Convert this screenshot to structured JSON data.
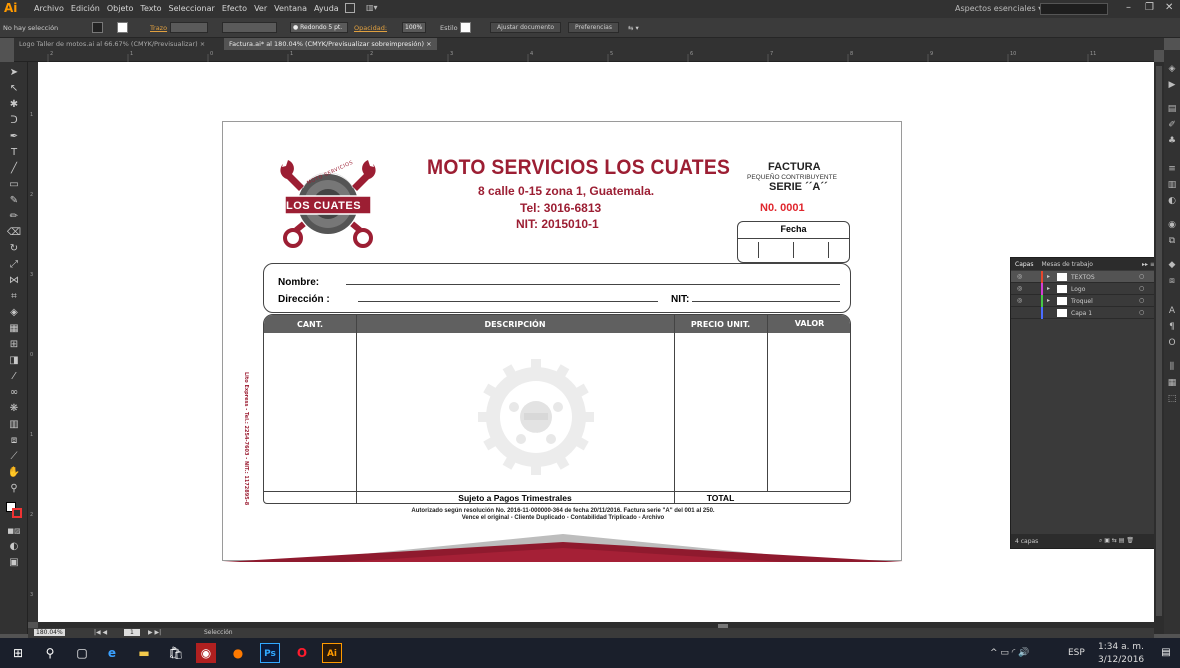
{
  "app": {
    "logo": "Ai",
    "menus": [
      "Archivo",
      "Edición",
      "Objeto",
      "Texto",
      "Seleccionar",
      "Efecto",
      "Ver",
      "Ventana",
      "Ayuda"
    ],
    "workspace": "Aspectos esenciales",
    "window_controls": [
      "–",
      "❐",
      "✕"
    ]
  },
  "controlbar": {
    "selection": "No hay selección",
    "stroke_label": "Trazo",
    "brush": "● Redondo 5 pt.",
    "opacity_label": "Opacidad:",
    "opacity_value": "100%",
    "style_label": "Estilo",
    "fit_doc": "Ajustar documento",
    "prefs": "Preferencias"
  },
  "tabs": [
    {
      "label": "Logo Taller de motos.ai al 66.67% (CMYK/Previsualizar)",
      "close": "×"
    },
    {
      "label": "Factura.ai* al 180.04% (CMYK/Previsualizar sobreimpresión)",
      "close": "×"
    }
  ],
  "ruler_h_ticks": [
    "2",
    "1",
    "0",
    "1",
    "2",
    "3",
    "4",
    "5",
    "6",
    "7",
    "8",
    "9",
    "10",
    "11"
  ],
  "ruler_v_ticks": [
    "1",
    "2",
    "3",
    "0",
    "1",
    "2",
    "3",
    "4"
  ],
  "invoice": {
    "company": "MOTO SERVICIOS LOS CUATES",
    "address": "8 calle 0-15 zona 1, Guatemala.",
    "tel": "Tel: 3016-6813",
    "nit": "NIT: 2015010-1",
    "logo_top": "MOTO SERVICIOS",
    "logo_banner": "LOS CUATES",
    "factura": "FACTURA",
    "contribuyente": "PEQUEÑO CONTRIBUYENTE",
    "serie": "SERIE ´´A´´",
    "numero": "N0. 0001",
    "fecha": "Fecha",
    "nombre": "Nombre:",
    "direccion": "Dirección :",
    "nit_label": "NIT:",
    "col_cant": "CANT.",
    "col_desc": "DESCRIPCIÓN",
    "col_precio": "PRECIO UNIT.",
    "col_valor": "VALOR",
    "sujeto": "Sujeto a Pagos Trimestrales",
    "total": "TOTAL",
    "footer1": "Autorizado según resolución No. 2016-11-000000-364 de fecha 20/11/2016. Factura serie \"A\" del 001 al 250.",
    "footer2": "Vence el original - Cliente  Duplicado - Contabilidad   Triplicado - Archivo",
    "side_text": "Lito Express - Tel.: 2254-7603 - NIT.: 1172895-8",
    "watermark_label": "LOS CUATES"
  },
  "layers": {
    "tab1": "Capas",
    "tab2": "Mesas de trabajo",
    "rows": [
      {
        "name": "TEXTOS",
        "color": "#e8462d"
      },
      {
        "name": "Logo",
        "color": "#d43dd4"
      },
      {
        "name": "Troquel",
        "color": "#46c846"
      },
      {
        "name": "Capa 1",
        "color": "#4a6cff"
      }
    ],
    "count": "4 capas"
  },
  "status": {
    "zoom": "180.04%",
    "page": "1",
    "mode": "Selección"
  },
  "taskbar": {
    "lang": "ESP",
    "time": "1:34 a. m.",
    "date": "3/12/2016"
  }
}
